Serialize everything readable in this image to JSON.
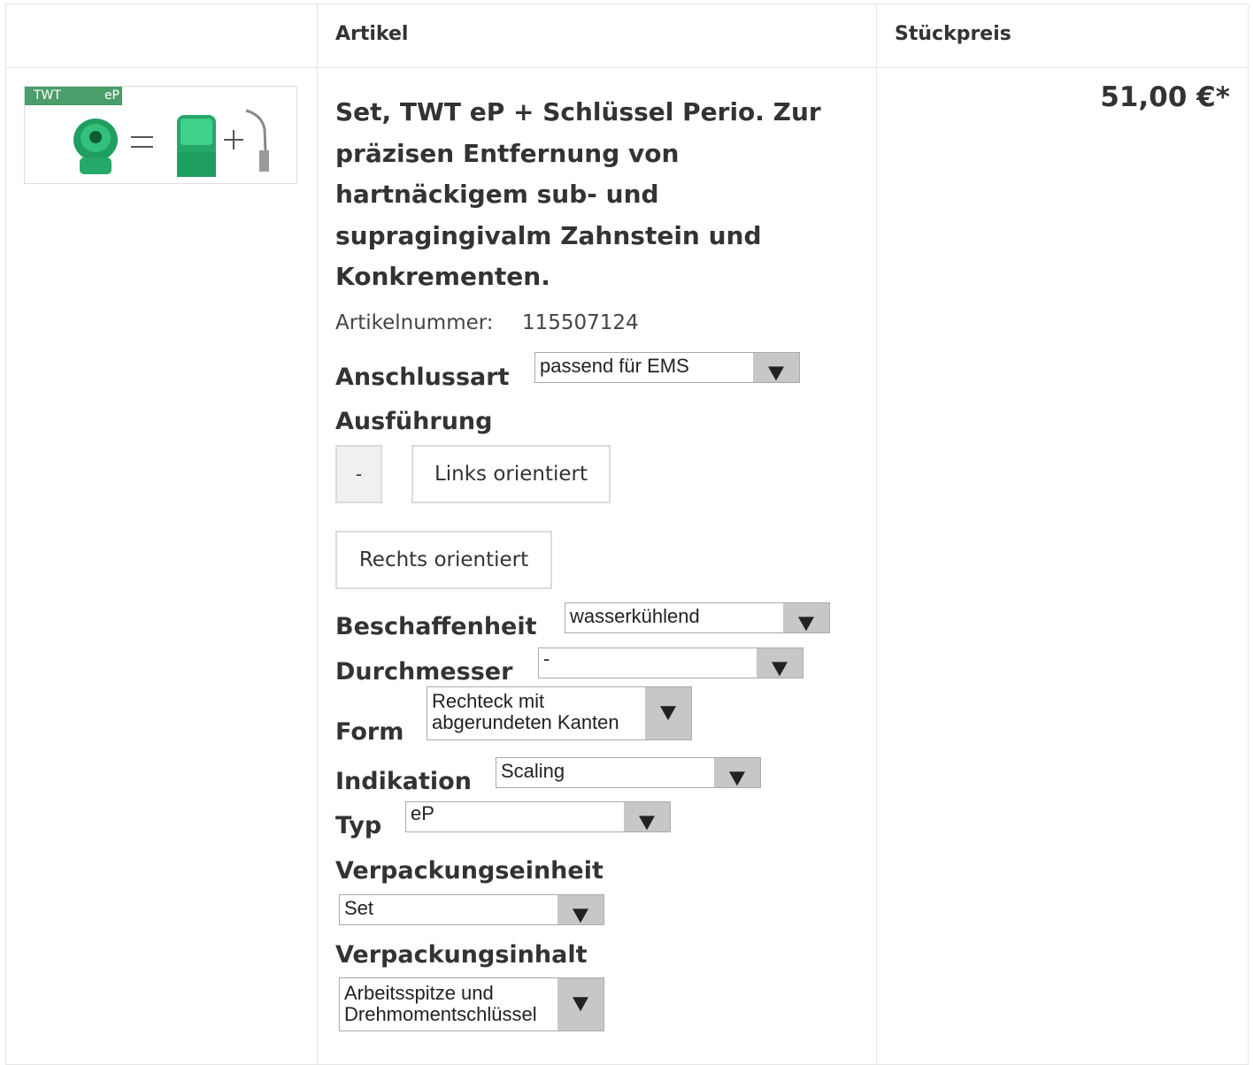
{
  "table": {
    "headers": {
      "artikel": "Artikel",
      "stueckpreis": "Stückpreis"
    }
  },
  "product": {
    "image": {
      "tag_left": "TWT",
      "tag_right": "eP"
    },
    "title": "Set, TWT eP + Schlüssel Perio. Zur präzisen Entfernung von hartnäckigem sub- und supragingivalm Zahnstein und Konkrementen.",
    "artikelnummer_label": "Artikelnummer:",
    "artikelnummer": "115507124",
    "price": "51,00 €*"
  },
  "options": {
    "anschlussart": {
      "label": "Anschlussart",
      "value": "passend für EMS"
    },
    "ausfuehrung": {
      "label": "Ausführung",
      "choices": [
        "-",
        "Links orientiert",
        "Rechts orientiert"
      ],
      "selected": "-"
    },
    "beschaffenheit": {
      "label": "Beschaffenheit",
      "value": "wasserkühlend"
    },
    "durchmesser": {
      "label": "Durchmesser",
      "value": "-"
    },
    "form": {
      "label": "Form",
      "value": "Rechteck mit\nabgerundeten Kanten"
    },
    "indikation": {
      "label": "Indikation",
      "value": "Scaling"
    },
    "typ": {
      "label": "Typ",
      "value": "eP"
    },
    "verpackungseinheit": {
      "label": "Verpackungseinheit",
      "value": "Set"
    },
    "verpackungsinhalt": {
      "label": "Verpackungsinhalt",
      "value": "Arbeitsspitze und\nDrehmomentschlüssel"
    }
  },
  "colors": {
    "image_tag_bg": "#4a9e6a",
    "select_button": "#c7c7c7",
    "border": "#e4e6e8"
  }
}
